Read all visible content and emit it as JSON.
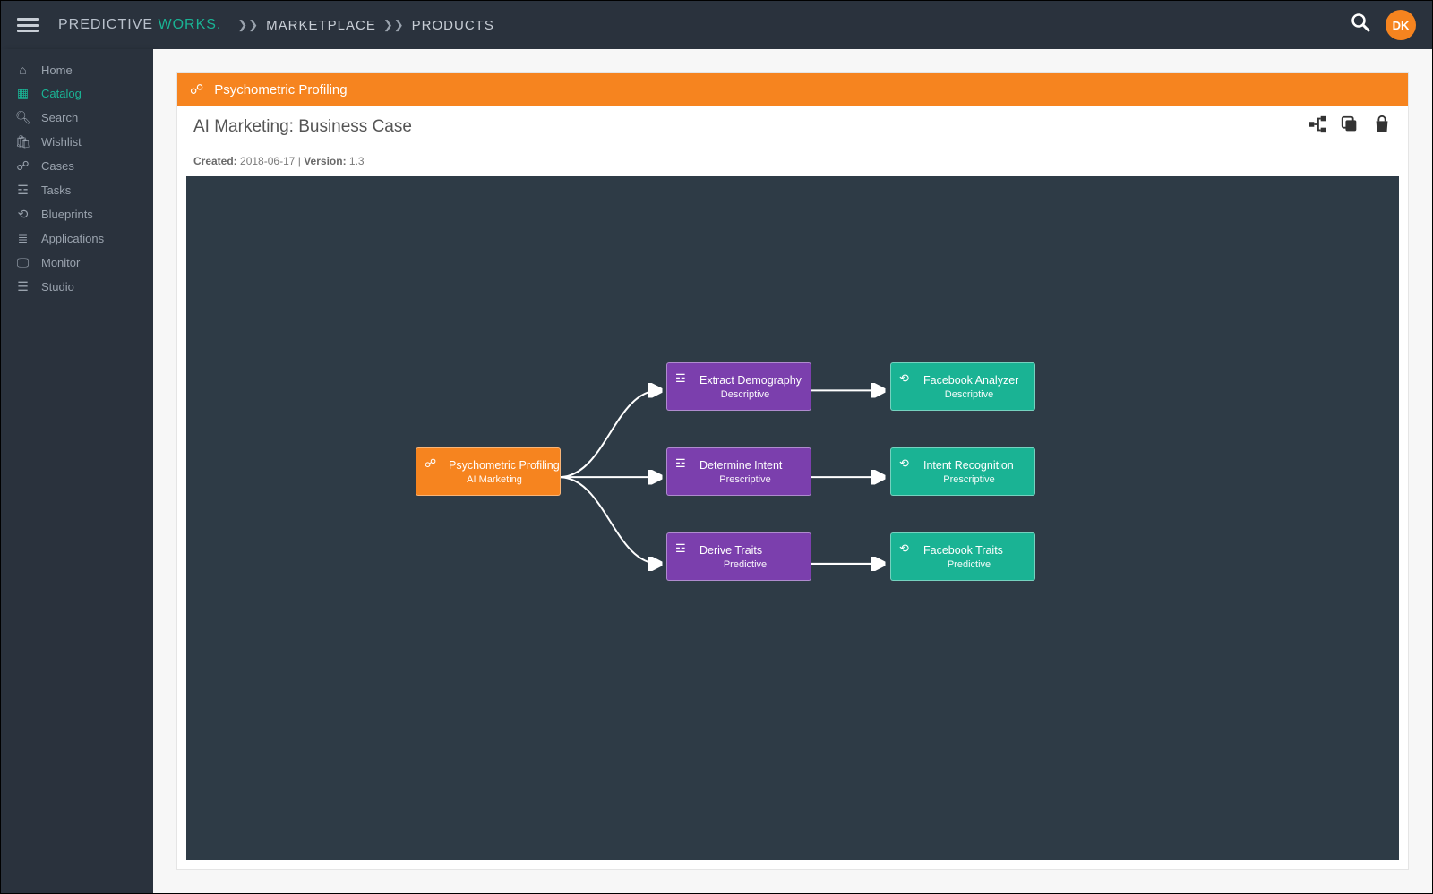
{
  "brand": {
    "part1": "PREDICTIVE ",
    "part2": "WORKS."
  },
  "breadcrumb": {
    "items": [
      "MARKETPLACE",
      "PRODUCTS"
    ]
  },
  "avatar_initials": "DK",
  "sidebar": {
    "items": [
      {
        "label": "Home",
        "icon": "home"
      },
      {
        "label": "Catalog",
        "icon": "grid",
        "active": true
      },
      {
        "label": "Search",
        "icon": "search"
      },
      {
        "label": "Wishlist",
        "icon": "bag"
      },
      {
        "label": "Cases",
        "icon": "sitemap"
      },
      {
        "label": "Tasks",
        "icon": "tasks"
      },
      {
        "label": "Blueprints",
        "icon": "share"
      },
      {
        "label": "Applications",
        "icon": "layers"
      },
      {
        "label": "Monitor",
        "icon": "monitor"
      },
      {
        "label": "Studio",
        "icon": "lines"
      }
    ]
  },
  "card": {
    "banner_label": "Psychometric Profiling",
    "title": "AI Marketing: Business Case",
    "created_label": "Created:",
    "created_value": "2018-06-17",
    "version_label": "Version:",
    "version_value": "1.3"
  },
  "diagram": {
    "nodes": {
      "root": {
        "title": "Psychometric Profiling",
        "subtitle": "AI Marketing"
      },
      "m1": {
        "title": "Extract Demography",
        "subtitle": "Descriptive"
      },
      "m2": {
        "title": "Determine Intent",
        "subtitle": "Prescriptive"
      },
      "m3": {
        "title": "Derive Traits",
        "subtitle": "Predictive"
      },
      "r1": {
        "title": "Facebook Analyzer",
        "subtitle": "Descriptive"
      },
      "r2": {
        "title": "Intent Recognition",
        "subtitle": "Prescriptive"
      },
      "r3": {
        "title": "Facebook Traits",
        "subtitle": "Predictive"
      }
    }
  }
}
